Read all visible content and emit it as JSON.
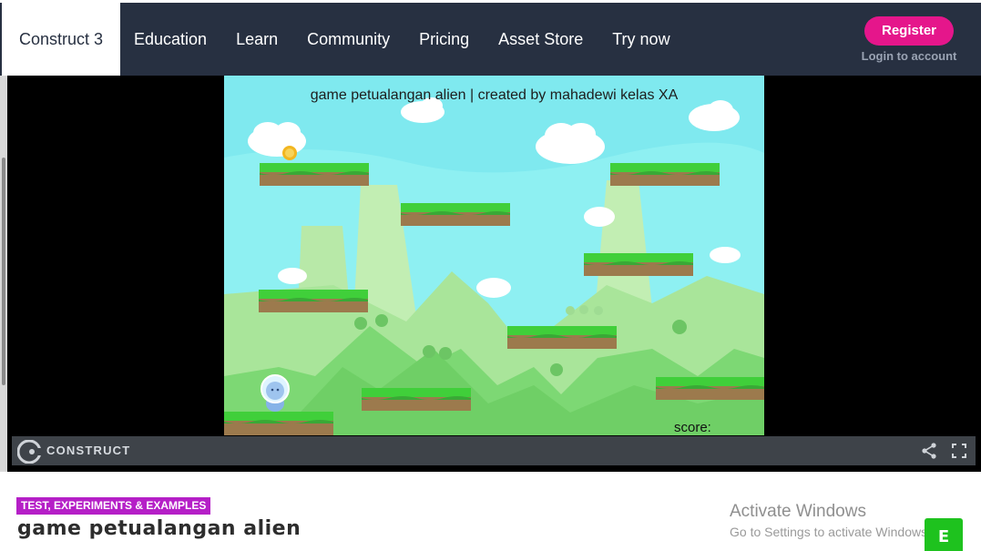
{
  "nav": {
    "brand": "Construct 3",
    "links": [
      "Education",
      "Learn",
      "Community",
      "Pricing",
      "Asset Store",
      "Try now"
    ],
    "register": "Register",
    "login": "Login to account"
  },
  "game": {
    "title": "game petualangan alien | created by mahadewi kelas XA",
    "score_label": "score:"
  },
  "player_bar": {
    "logo_text": "CONSTRUCT",
    "icons": [
      "construct-logo-icon",
      "share-icon",
      "fullscreen-icon"
    ]
  },
  "page": {
    "category": "TEST, EXPERIMENTS & EXAMPLES",
    "title": "game petualangan alien"
  },
  "watermark": {
    "title": "Activate Windows",
    "subtitle": "Go to Settings to activate Windows."
  },
  "badge": "E",
  "colors": {
    "nav_bg": "#273041",
    "register": "#e5168b",
    "category": "#b51fc7",
    "sky": "#7fe9ef",
    "grass": "#3fcf3a",
    "badge": "#1ec21e"
  }
}
